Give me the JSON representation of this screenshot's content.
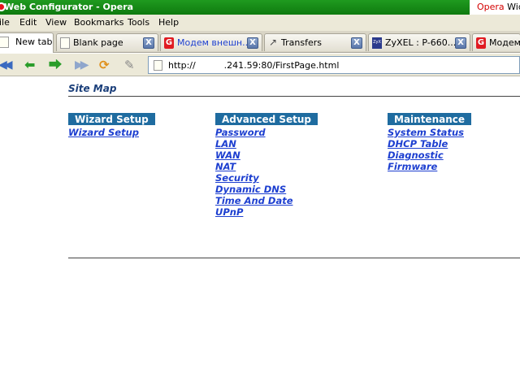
{
  "window": {
    "title": "Web Configurator - Opera",
    "right_label_brand": "Opera",
    "right_label_rest": " Wid"
  },
  "menu": [
    {
      "label": "ile"
    },
    {
      "label": "Edit"
    },
    {
      "label": "View"
    },
    {
      "label": "Bookmarks"
    },
    {
      "label": "Tools"
    },
    {
      "label": "Help"
    }
  ],
  "tabs": [
    {
      "label": "New tab",
      "icon": "page-icon"
    },
    {
      "label": "Blank page",
      "icon": "page-icon"
    },
    {
      "label": "Модем внешн...",
      "icon": "g-logo-icon"
    },
    {
      "label": "Transfers",
      "icon": "satellite-icon"
    },
    {
      "label": "ZyXEL : P-660...",
      "icon": "zyxel-icon"
    },
    {
      "label": "Модем в",
      "icon": "g-logo-icon"
    }
  ],
  "tab_close_glyph": "X",
  "address": {
    "url": "http://          .241.59:80/FirstPage.html"
  },
  "page": {
    "title": "Site Map",
    "columns": [
      {
        "heading": "Wizard Setup",
        "links": [
          "Wizard Setup"
        ]
      },
      {
        "heading": "Advanced Setup",
        "links": [
          "Password",
          "LAN",
          "WAN",
          "NAT",
          "Security",
          "Dynamic DNS",
          "Time And Date",
          "UPnP"
        ]
      },
      {
        "heading": "Maintenance",
        "links": [
          "System Status",
          "DHCP Table",
          "Diagnostic",
          "Firmware"
        ]
      }
    ]
  },
  "colors": {
    "title_bar": "#1f9a1f",
    "heading_bg": "#1f6ca0",
    "link": "#1d3fd0",
    "sitemap_title": "#1b3f7a"
  }
}
